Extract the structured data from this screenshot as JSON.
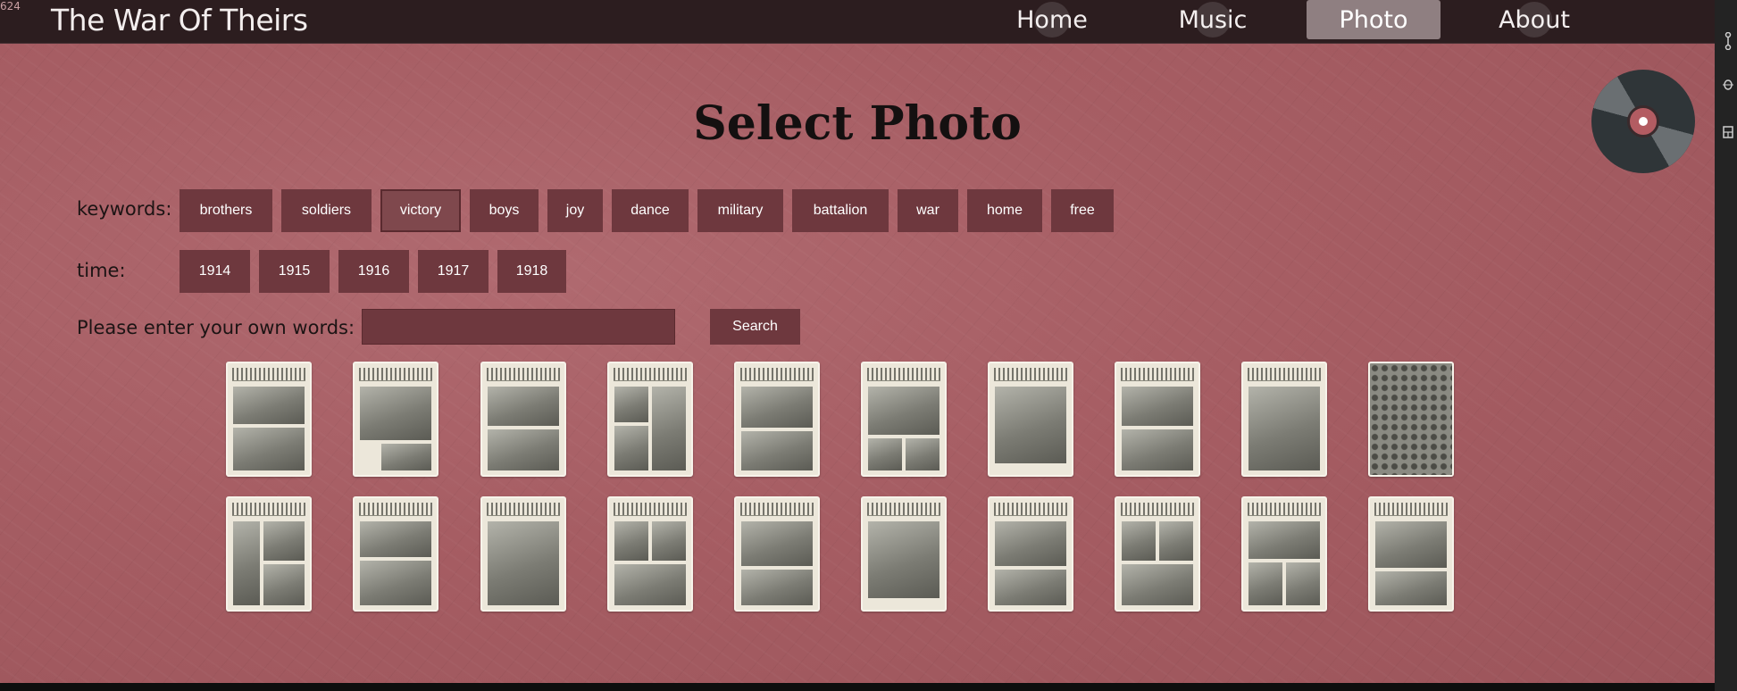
{
  "corner_text": "624",
  "brand": "The War Of Theirs",
  "nav": [
    {
      "label": "Home",
      "active": false
    },
    {
      "label": "Music",
      "active": false
    },
    {
      "label": "Photo",
      "active": true
    },
    {
      "label": "About",
      "active": false
    }
  ],
  "page_title": "Select Photo",
  "keywords": {
    "label": "keywords:",
    "items": [
      "brothers",
      "soldiers",
      "victory",
      "boys",
      "joy",
      "dance",
      "military",
      "battalion",
      "war",
      "home",
      "free"
    ],
    "active": "victory"
  },
  "time": {
    "label": "time:",
    "items": [
      "1914",
      "1915",
      "1916",
      "1917",
      "1918"
    ]
  },
  "search": {
    "label": "Please enter your own words:",
    "value": "",
    "placeholder": "",
    "button_label": "Search"
  },
  "thumbnail_rows": 2,
  "thumbnails_per_row": 10,
  "colors": {
    "page_bg": "#a65d63",
    "topbar": "#2c1d1f",
    "button": "#6e383e",
    "nav_active": "#8f7f81"
  },
  "icons": [
    "music-disc-icon"
  ]
}
